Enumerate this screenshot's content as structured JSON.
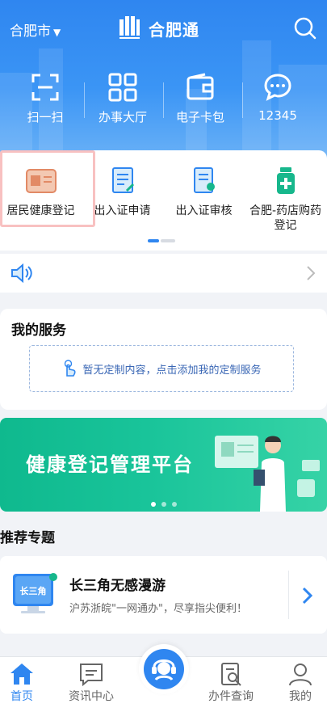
{
  "header": {
    "city": "合肥市",
    "brand": "合肥通",
    "quick_actions": [
      {
        "label": "扫一扫",
        "icon": "scan-icon"
      },
      {
        "label": "办事大厅",
        "icon": "grid-icon"
      },
      {
        "label": "电子卡包",
        "icon": "wallet-icon"
      },
      {
        "label": "12345",
        "icon": "chat-icon"
      }
    ]
  },
  "services": [
    {
      "label": "居民健康登记",
      "icon": "id-card-icon"
    },
    {
      "label": "出入证申请",
      "icon": "document-edit-icon"
    },
    {
      "label": "出入证审核",
      "icon": "document-review-icon"
    },
    {
      "label": "合肥-药店购药登记",
      "icon": "medicine-icon"
    }
  ],
  "my_services": {
    "title": "我的服务",
    "empty_text": "暂无定制内容，点击添加我的定制服务"
  },
  "banner": {
    "text": "健康登记管理平台"
  },
  "recommend": {
    "title": "推荐专题",
    "item": {
      "title": "长三角无感漫游",
      "subtitle": "沪苏浙皖\"一网通办\"，尽享指尖便利！",
      "thumb_text": "长三角"
    }
  },
  "tabbar": [
    {
      "label": "首页",
      "icon": "home-icon",
      "active": true
    },
    {
      "label": "资讯中心",
      "icon": "news-icon",
      "active": false
    },
    {
      "label": "",
      "icon": "customer-service-icon",
      "active": false
    },
    {
      "label": "办件查询",
      "icon": "search-document-icon",
      "active": false
    },
    {
      "label": "我的",
      "icon": "user-icon",
      "active": false
    }
  ],
  "colors": {
    "primary": "#2f86f0",
    "banner_green": "#19c49a",
    "highlight": "#f8c1c1"
  }
}
